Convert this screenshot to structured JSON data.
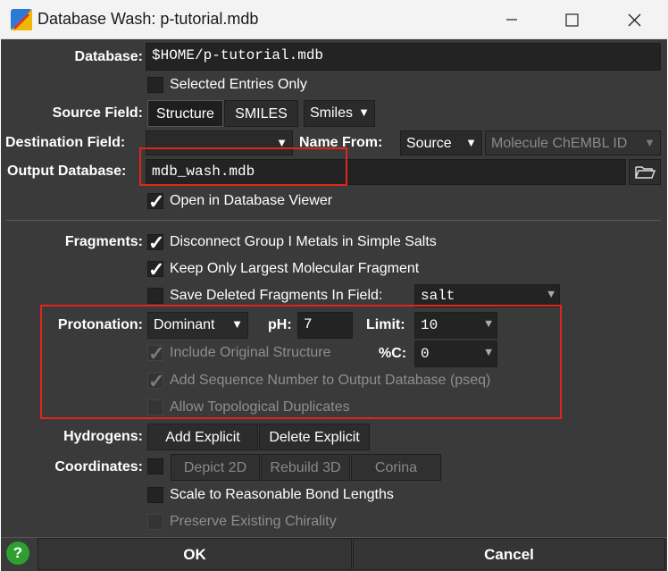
{
  "window": {
    "title": "Database Wash: p-tutorial.mdb",
    "minimize": "—",
    "maximize": "☐",
    "close": "✕"
  },
  "database": {
    "label": "Database:",
    "value": "$HOME/p-tutorial.mdb"
  },
  "selected_entries": {
    "label": "Selected Entries Only",
    "checked": false
  },
  "source_field": {
    "label": "Source Field:",
    "btn_structure": "Structure",
    "btn_smiles": "SMILES",
    "dropdown": "Smiles"
  },
  "destination_field": {
    "label": "Destination Field:",
    "value": "",
    "name_from_label": "Name From:",
    "name_from_value": "Source",
    "name_field_value": "Molecule ChEMBL ID"
  },
  "output_database": {
    "label": "Output Database:",
    "value": "mdb_wash.mdb",
    "open_viewer_label": "Open in Database Viewer",
    "open_viewer_checked": true
  },
  "fragments": {
    "label": "Fragments:",
    "disconnect": "Disconnect Group I Metals in Simple Salts",
    "keep_largest": "Keep Only Largest Molecular Fragment",
    "save_deleted": "Save Deleted Fragments In Field:",
    "save_field": "salt"
  },
  "protonation": {
    "label": "Protonation:",
    "mode": "Dominant",
    "ph_label": "pH:",
    "ph_value": "7",
    "limit_label": "Limit:",
    "limit_value": "10",
    "include_original": "Include Original Structure",
    "pc_label": "%C:",
    "pc_value": "0",
    "add_sequence": "Add Sequence Number to Output Database (pseq)",
    "allow_topological": "Allow Topological Duplicates"
  },
  "hydrogens": {
    "label": "Hydrogens:",
    "add": "Add Explicit",
    "delete": "Delete Explicit"
  },
  "coordinates": {
    "label": "Coordinates:",
    "depict": "Depict 2D",
    "rebuild": "Rebuild 3D",
    "corina": "Corina",
    "scale": "Scale to Reasonable Bond Lengths",
    "preserve": "Preserve Existing Chirality"
  },
  "footer": {
    "help": "?",
    "ok": "OK",
    "cancel": "Cancel"
  },
  "colors": {
    "dialog_bg": "#3a3a3a",
    "highlight": "#e1251b",
    "help_green": "#2fa02f"
  }
}
